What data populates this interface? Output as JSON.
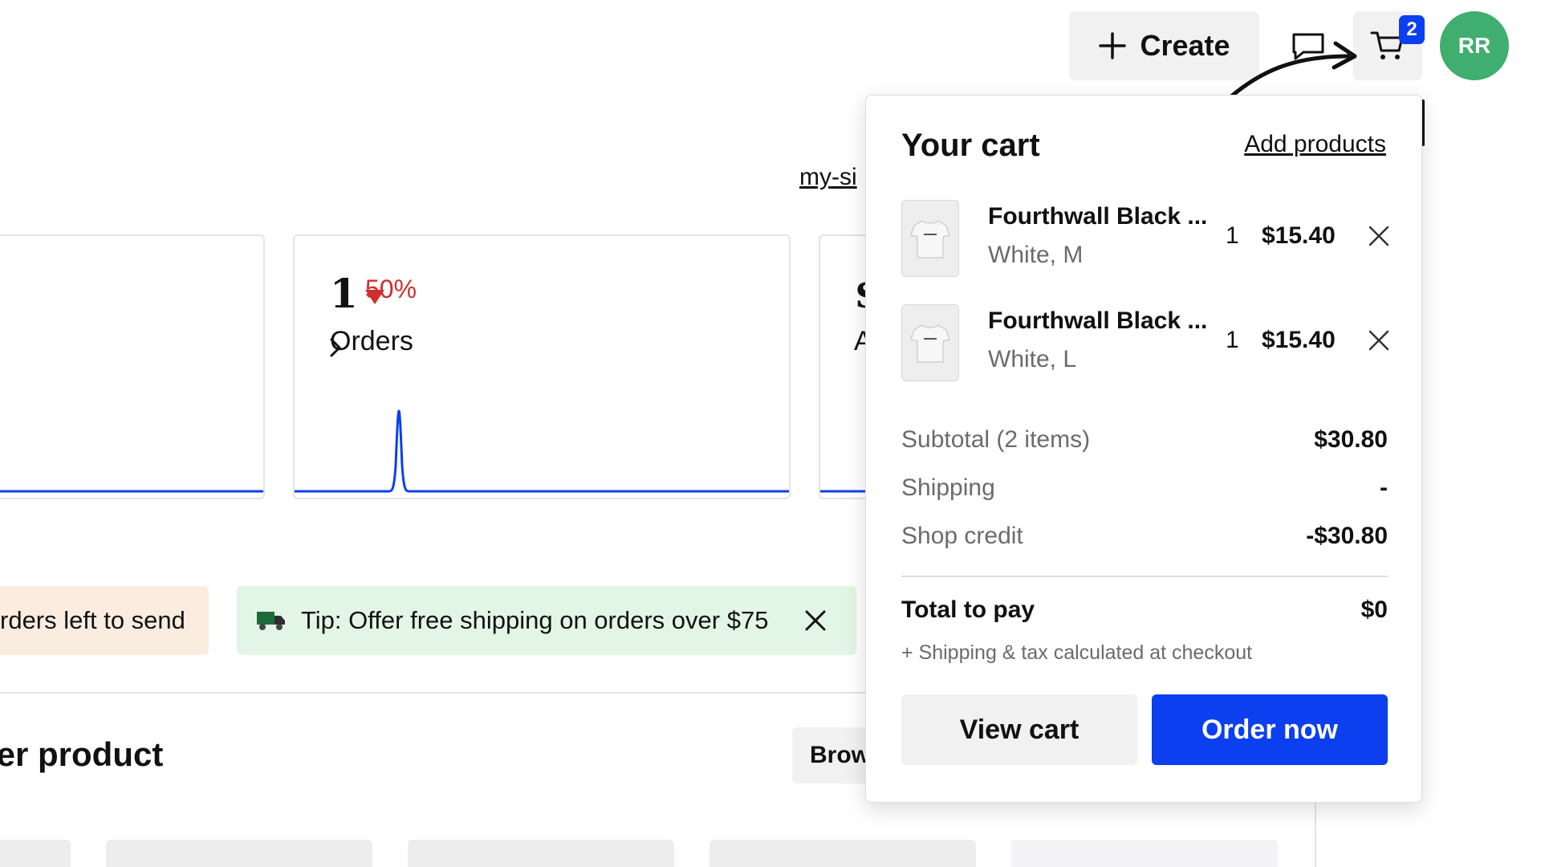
{
  "header": {
    "create_label": "Create",
    "cart_count": "2",
    "avatar_initials": "RR",
    "avatar_color": "#3fae6e",
    "accent_color": "#0b3ff0"
  },
  "dashboard": {
    "site_link": "my-si",
    "orders_card": {
      "value": "1",
      "change": "50%",
      "change_direction": "down",
      "label": "Orders"
    },
    "third_card": {
      "value_partial": "$",
      "label_partial": "A"
    },
    "banners": {
      "orders_left": "rders left to send",
      "tip": "Tip: Offer free shipping on orders over $75"
    },
    "section_title": "her product",
    "browse_label": "Brow"
  },
  "cart": {
    "title": "Your cart",
    "add_products": "Add products",
    "items": [
      {
        "name": "Fourthwall Black ...",
        "variant": "White, M",
        "qty": "1",
        "price": "$15.40",
        "thumb_icon": "tshirt-icon"
      },
      {
        "name": "Fourthwall Black ...",
        "variant": "White, L",
        "qty": "1",
        "price": "$15.40",
        "thumb_icon": "tshirt-icon"
      }
    ],
    "summary": {
      "subtotal_label": "Subtotal (2 items)",
      "subtotal_value": "$30.80",
      "shipping_label": "Shipping",
      "shipping_value": "-",
      "credit_label": "Shop credit",
      "credit_value": "-$30.80",
      "total_label": "Total to pay",
      "total_value": "$0",
      "note": "+ Shipping & tax calculated at checkout"
    },
    "view_cart_label": "View cart",
    "order_now_label": "Order now"
  }
}
